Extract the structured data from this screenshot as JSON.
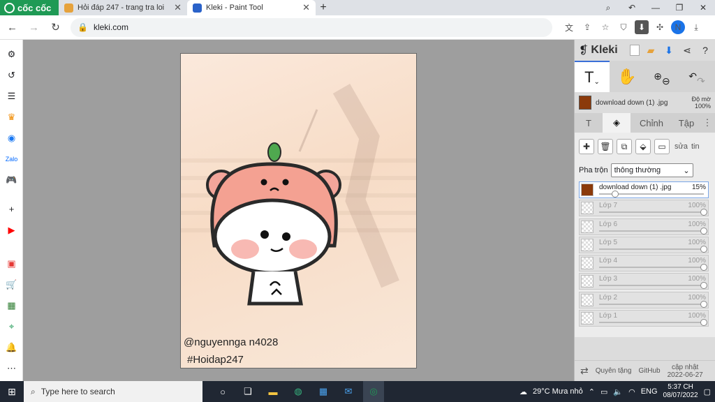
{
  "browser": {
    "brand": "cốc cốc",
    "tabs": [
      {
        "label": "Hỏi đáp 247 - trang tra loi",
        "active": false
      },
      {
        "label": "Kleki - Paint Tool",
        "active": true
      }
    ],
    "url": "kleki.com",
    "profile_initial": "N"
  },
  "canvas": {
    "watermark_1": "@nguyennga n4028",
    "watermark_2": "#Hoidap247"
  },
  "kleki": {
    "logo": "Kleki",
    "current_layer": {
      "name": "download down (1) .jpg",
      "opacity_label": "Độ mờ",
      "opacity": "100%"
    },
    "tabs": [
      "Chỉnh",
      "Tập tin"
    ],
    "edit_tab_suffix": "sửa",
    "blend_label": "Pha trộn",
    "blend_value": "thông thường",
    "layers": [
      {
        "name": "download down (1) .jpg",
        "opacity": "15%",
        "opacity_value": 0.15,
        "selected": true
      },
      {
        "name": "Lớp 7",
        "opacity": "100%",
        "opacity_value": 1
      },
      {
        "name": "Lớp 6",
        "opacity": "100%",
        "opacity_value": 1
      },
      {
        "name": "Lớp 5",
        "opacity": "100%",
        "opacity_value": 1
      },
      {
        "name": "Lớp 4",
        "opacity": "100%",
        "opacity_value": 1
      },
      {
        "name": "Lớp 3",
        "opacity": "100%",
        "opacity_value": 1
      },
      {
        "name": "Lớp 2",
        "opacity": "100%",
        "opacity_value": 1
      },
      {
        "name": "Lớp 1",
        "opacity": "100%",
        "opacity_value": 1
      }
    ],
    "footer": {
      "donate": "Quyên tặng",
      "github": "GitHub",
      "updated_label": "cập nhật",
      "updated_date": "2022-06-27"
    }
  },
  "taskbar": {
    "search_placeholder": "Type here to search",
    "weather": "29°C Mưa nhỏ",
    "lang": "ENG",
    "time": "5:37 CH",
    "date": "08/07/2022"
  }
}
